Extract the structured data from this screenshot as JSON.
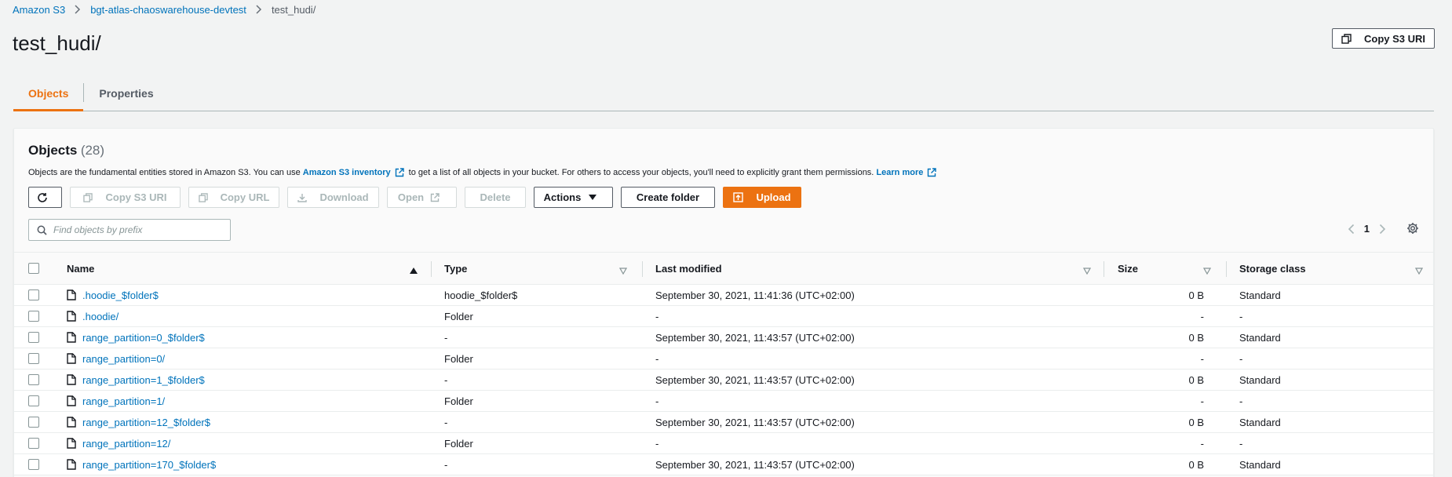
{
  "breadcrumb": {
    "items": [
      "Amazon S3",
      "bgt-atlas-chaoswarehouse-devtest"
    ],
    "current": "test_hudi/"
  },
  "page_title": "test_hudi/",
  "copy_s3_uri_label": "Copy S3 URI",
  "tabs": [
    {
      "label": "Objects",
      "active": true
    },
    {
      "label": "Properties",
      "active": false
    }
  ],
  "objects": {
    "title": "Objects",
    "count": "(28)",
    "description": {
      "part1": "Objects are the fundamental entities stored in Amazon S3. You can use",
      "link1": "Amazon S3 inventory",
      "part2": "to get a list of all objects in your bucket. For others to access your objects, you'll need to explicitly grant them permissions.",
      "link2": "Learn more"
    },
    "toolbar": {
      "copy_s3_uri": "Copy S3 URI",
      "copy_url": "Copy URL",
      "download": "Download",
      "open": "Open",
      "delete": "Delete",
      "actions": "Actions",
      "create_folder": "Create folder",
      "upload": "Upload"
    },
    "search_placeholder": "Find objects by prefix",
    "page": "1"
  },
  "table": {
    "headers": {
      "name": "Name",
      "type": "Type",
      "last_modified": "Last modified",
      "size": "Size",
      "storage_class": "Storage class"
    },
    "rows": [
      {
        "icon": "file-icon",
        "name": ".hoodie_$folder$",
        "type": "hoodie_$folder$",
        "modified": "September 30, 2021, 11:41:36 (UTC+02:00)",
        "size": "0 B",
        "storage": "Standard"
      },
      {
        "icon": "folder-icon",
        "name": ".hoodie/",
        "type": "Folder",
        "modified": "-",
        "size": "-",
        "storage": "-"
      },
      {
        "icon": "file-icon",
        "name": "range_partition=0_$folder$",
        "type": "-",
        "modified": "September 30, 2021, 11:43:57 (UTC+02:00)",
        "size": "0 B",
        "storage": "Standard"
      },
      {
        "icon": "folder-icon",
        "name": "range_partition=0/",
        "type": "Folder",
        "modified": "-",
        "size": "-",
        "storage": "-"
      },
      {
        "icon": "file-icon",
        "name": "range_partition=1_$folder$",
        "type": "-",
        "modified": "September 30, 2021, 11:43:57 (UTC+02:00)",
        "size": "0 B",
        "storage": "Standard"
      },
      {
        "icon": "folder-icon",
        "name": "range_partition=1/",
        "type": "Folder",
        "modified": "-",
        "size": "-",
        "storage": "-"
      },
      {
        "icon": "file-icon",
        "name": "range_partition=12_$folder$",
        "type": "-",
        "modified": "September 30, 2021, 11:43:57 (UTC+02:00)",
        "size": "0 B",
        "storage": "Standard"
      },
      {
        "icon": "folder-icon",
        "name": "range_partition=12/",
        "type": "Folder",
        "modified": "-",
        "size": "-",
        "storage": "-"
      },
      {
        "icon": "file-icon",
        "name": "range_partition=170_$folder$",
        "type": "-",
        "modified": "September 30, 2021, 11:43:57 (UTC+02:00)",
        "size": "0 B",
        "storage": "Standard"
      }
    ]
  },
  "colors": {
    "accent": "#ec7211",
    "link": "#0073bb",
    "background": "#f2f3f3"
  }
}
